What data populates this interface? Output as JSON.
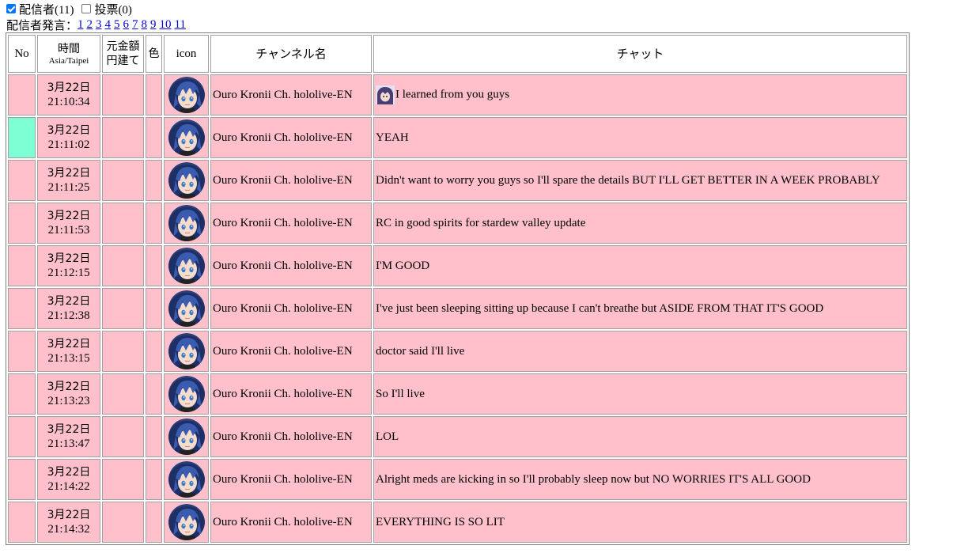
{
  "filters": {
    "streamer_label": "配信者(11)",
    "streamer_checked": true,
    "vote_label": "投票(0)",
    "vote_checked": false
  },
  "pager": {
    "label": "配信者発言：",
    "pages": [
      "1",
      "2",
      "3",
      "4",
      "5",
      "6",
      "7",
      "8",
      "9",
      "10",
      "11"
    ]
  },
  "table": {
    "headers": {
      "no": "No",
      "time": "時間",
      "timezone": "Asia/Taipei",
      "amount_line1": "元金額",
      "amount_line2": "円建て",
      "color": "色",
      "icon": "icon",
      "channel": "チャンネル名",
      "chat": "チャット"
    },
    "colors": {
      "row_bg": "#ffc0cb",
      "highlight_no": "#7fffd4"
    },
    "rows": [
      {
        "date": "3月22日",
        "time": "21:10:34",
        "channel": "Ouro Kronii Ch. hololive-EN",
        "message": "I learned from you guys",
        "emote": true,
        "highlight": false
      },
      {
        "date": "3月22日",
        "time": "21:11:02",
        "channel": "Ouro Kronii Ch. hololive-EN",
        "message": "YEAH",
        "emote": false,
        "highlight": true
      },
      {
        "date": "3月22日",
        "time": "21:11:25",
        "channel": "Ouro Kronii Ch. hololive-EN",
        "message": "Didn't want to worry you guys so I'll spare the details BUT I'LL GET BETTER IN A WEEK PROBABLY",
        "emote": false,
        "highlight": false
      },
      {
        "date": "3月22日",
        "time": "21:11:53",
        "channel": "Ouro Kronii Ch. hololive-EN",
        "message": "RC in good spirits for stardew valley update",
        "emote": false,
        "highlight": false
      },
      {
        "date": "3月22日",
        "time": "21:12:15",
        "channel": "Ouro Kronii Ch. hololive-EN",
        "message": "I'M GOOD",
        "emote": false,
        "highlight": false
      },
      {
        "date": "3月22日",
        "time": "21:12:38",
        "channel": "Ouro Kronii Ch. hololive-EN",
        "message": "I've just been sleeping sitting up because I can't breathe but ASIDE FROM THAT IT'S GOOD",
        "emote": false,
        "highlight": false
      },
      {
        "date": "3月22日",
        "time": "21:13:15",
        "channel": "Ouro Kronii Ch. hololive-EN",
        "message": "doctor said I'll live",
        "emote": false,
        "highlight": false
      },
      {
        "date": "3月22日",
        "time": "21:13:23",
        "channel": "Ouro Kronii Ch. hololive-EN",
        "message": "So I'll live",
        "emote": false,
        "highlight": false
      },
      {
        "date": "3月22日",
        "time": "21:13:47",
        "channel": "Ouro Kronii Ch. hololive-EN",
        "message": "LOL",
        "emote": false,
        "highlight": false
      },
      {
        "date": "3月22日",
        "time": "21:14:22",
        "channel": "Ouro Kronii Ch. hololive-EN",
        "message": "Alright meds are kicking in so I'll probably sleep now but NO WORRIES IT'S ALL GOOD",
        "emote": false,
        "highlight": false
      },
      {
        "date": "3月22日",
        "time": "21:14:32",
        "channel": "Ouro Kronii Ch. hololive-EN",
        "message": "EVERYTHING IS SO LIT",
        "emote": false,
        "highlight": false
      }
    ]
  }
}
